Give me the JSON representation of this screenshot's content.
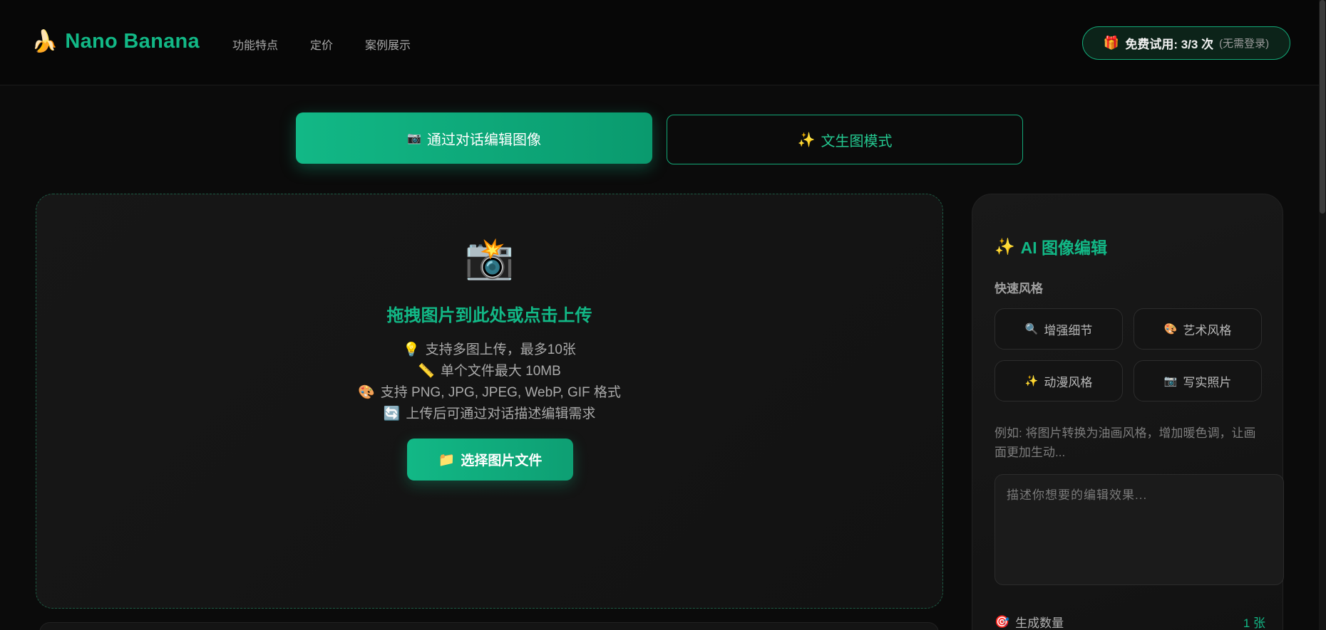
{
  "header": {
    "logo_icon": "🍌",
    "logo_text": "Nano Banana",
    "nav": [
      "功能特点",
      "定价",
      "案例展示"
    ],
    "trial_icon": "🎁",
    "trial_text": "免费试用: 3/3 次",
    "trial_note": "(无需登录)"
  },
  "modes": {
    "edit": {
      "icon": "📷",
      "label": "通过对话编辑图像"
    },
    "text2img": {
      "icon": "✨",
      "label": "文生图模式"
    }
  },
  "upload": {
    "icon": "📸",
    "title": "拖拽图片到此处或点击上传",
    "info": [
      {
        "icon": "💡",
        "text": "支持多图上传，最多10张"
      },
      {
        "icon": "📏",
        "text": "单个文件最大 10MB"
      },
      {
        "icon": "🎨",
        "text": "支持 PNG, JPG, JPEG, WebP, GIF 格式"
      },
      {
        "icon": "🔄",
        "text": "上传后可通过对话描述编辑需求"
      }
    ],
    "button_icon": "📁",
    "button_label": "选择图片文件"
  },
  "panel": {
    "title_icon": "✨",
    "title": "AI 图像编辑",
    "quick_styles_label": "快速风格",
    "styles": [
      {
        "icon": "🔍",
        "label": "增强细节"
      },
      {
        "icon": "🎨",
        "label": "艺术风格"
      },
      {
        "icon": "✨",
        "label": "动漫风格"
      },
      {
        "icon": "📷",
        "label": "写实照片"
      }
    ],
    "example": "例如: 将图片转换为油画风格，增加暖色调，让画面更加生动...",
    "textarea_placeholder": "描述你想要的编辑效果...",
    "count_icon": "🎯",
    "count_label": "生成数量",
    "count_value": "1 张"
  },
  "colors": {
    "accent": "#12b886",
    "background": "#0b0b0b"
  }
}
